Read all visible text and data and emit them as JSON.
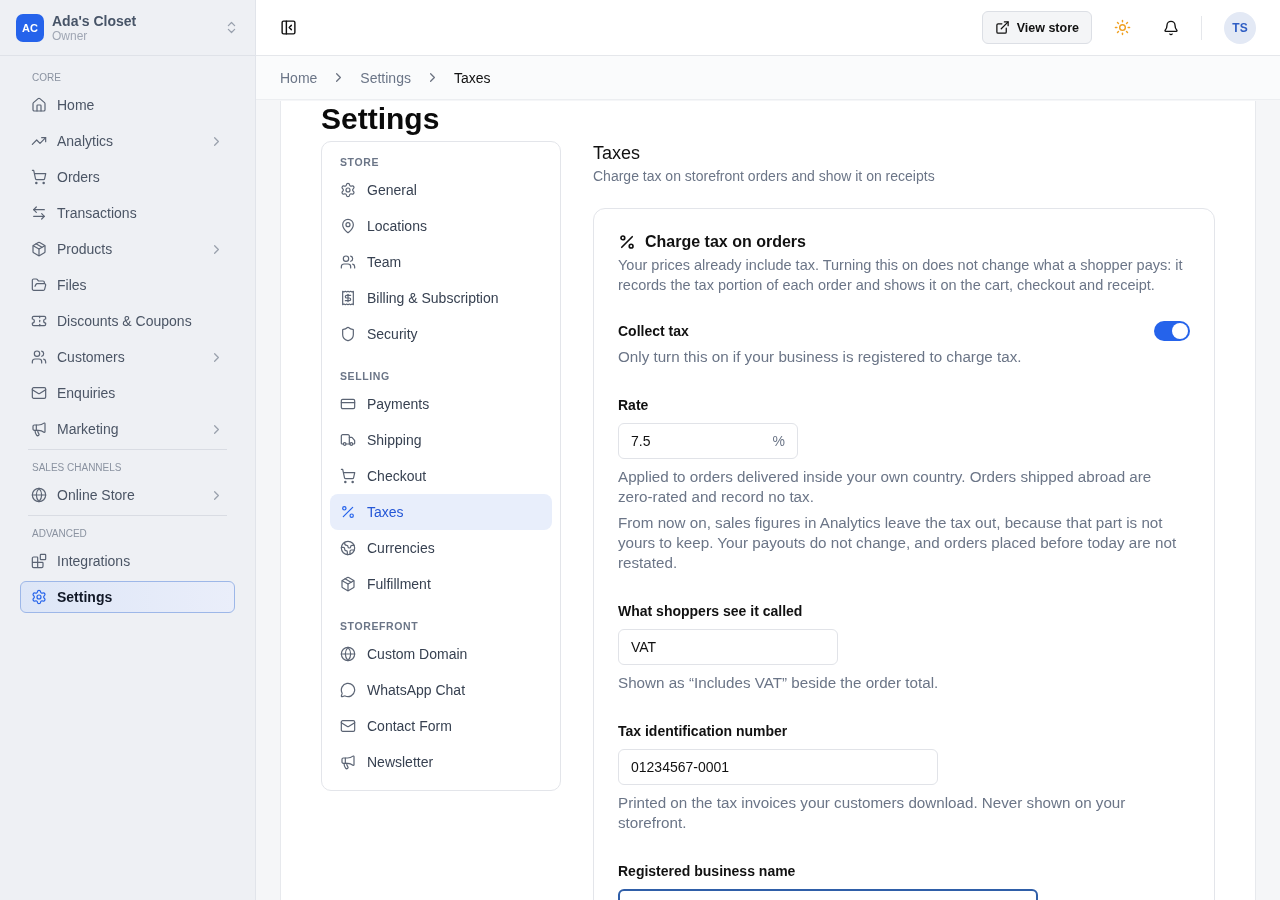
{
  "store": {
    "initials": "AC",
    "name": "Ada's Closet",
    "role": "Owner"
  },
  "sidebar": {
    "sections": [
      {
        "title": "CORE",
        "items": [
          {
            "label": "Home",
            "expandable": false,
            "selected": false
          },
          {
            "label": "Analytics",
            "expandable": true,
            "selected": false
          },
          {
            "label": "Orders",
            "expandable": false,
            "selected": false
          },
          {
            "label": "Transactions",
            "expandable": false,
            "selected": false
          },
          {
            "label": "Products",
            "expandable": true,
            "selected": false
          },
          {
            "label": "Files",
            "expandable": false,
            "selected": false
          },
          {
            "label": "Discounts & Coupons",
            "expandable": false,
            "selected": false
          },
          {
            "label": "Customers",
            "expandable": true,
            "selected": false
          },
          {
            "label": "Enquiries",
            "expandable": false,
            "selected": false
          },
          {
            "label": "Marketing",
            "expandable": true,
            "selected": false
          }
        ]
      },
      {
        "title": "SALES CHANNELS",
        "items": [
          {
            "label": "Online Store",
            "expandable": true,
            "selected": false
          }
        ]
      },
      {
        "title": "ADVANCED",
        "items": [
          {
            "label": "Integrations",
            "expandable": false,
            "selected": false
          },
          {
            "label": "Settings",
            "expandable": false,
            "selected": true
          }
        ]
      }
    ]
  },
  "topbar": {
    "view_store": "View store",
    "avatar": "TS"
  },
  "breadcrumbs": [
    "Home",
    "Settings",
    "Taxes"
  ],
  "page_title": "Settings",
  "settings_nav": [
    {
      "title": "STORE",
      "items": [
        {
          "label": "General",
          "selected": false
        },
        {
          "label": "Locations",
          "selected": false
        },
        {
          "label": "Team",
          "selected": false
        },
        {
          "label": "Billing & Subscription",
          "selected": false
        },
        {
          "label": "Security",
          "selected": false
        }
      ]
    },
    {
      "title": "SELLING",
      "items": [
        {
          "label": "Payments",
          "selected": false
        },
        {
          "label": "Shipping",
          "selected": false
        },
        {
          "label": "Checkout",
          "selected": false
        },
        {
          "label": "Taxes",
          "selected": true
        },
        {
          "label": "Currencies",
          "selected": false
        },
        {
          "label": "Fulfillment",
          "selected": false
        }
      ]
    },
    {
      "title": "STOREFRONT",
      "items": [
        {
          "label": "Custom Domain",
          "selected": false
        },
        {
          "label": "WhatsApp Chat",
          "selected": false
        },
        {
          "label": "Contact Form",
          "selected": false
        },
        {
          "label": "Newsletter",
          "selected": false
        }
      ]
    }
  ],
  "section": {
    "title": "Taxes",
    "subtitle": "Charge tax on storefront orders and show it on receipts"
  },
  "card": {
    "title": "Charge tax on orders",
    "description": "Your prices already include tax. Turning this on does not change what a shopper pays: it records the tax portion of each order and shows it on the cart, checkout and receipt.",
    "toggle": {
      "label": "Collect tax",
      "hint": "Only turn this on if your business is registered to charge tax.",
      "on": true
    },
    "fields": [
      {
        "label": "Rate",
        "value": "7.5",
        "suffix": "%",
        "hints": [
          "Applied to orders delivered inside your own country. Orders shipped abroad are zero-rated and record no tax.",
          "From now on, sales figures in Analytics leave the tax out, because that part is not yours to keep. Your payouts do not change, and orders placed before today are not restated."
        ]
      },
      {
        "label": "What shoppers see it called",
        "value": "VAT",
        "hints": [
          "Shown as “Includes VAT” beside the order total."
        ]
      },
      {
        "label": "Tax identification number",
        "value": "01234567-0001",
        "hints": [
          "Printed on the tax invoices your customers download. Never shown on your storefront."
        ]
      },
      {
        "label": "Registered business name",
        "focused": true
      }
    ]
  }
}
